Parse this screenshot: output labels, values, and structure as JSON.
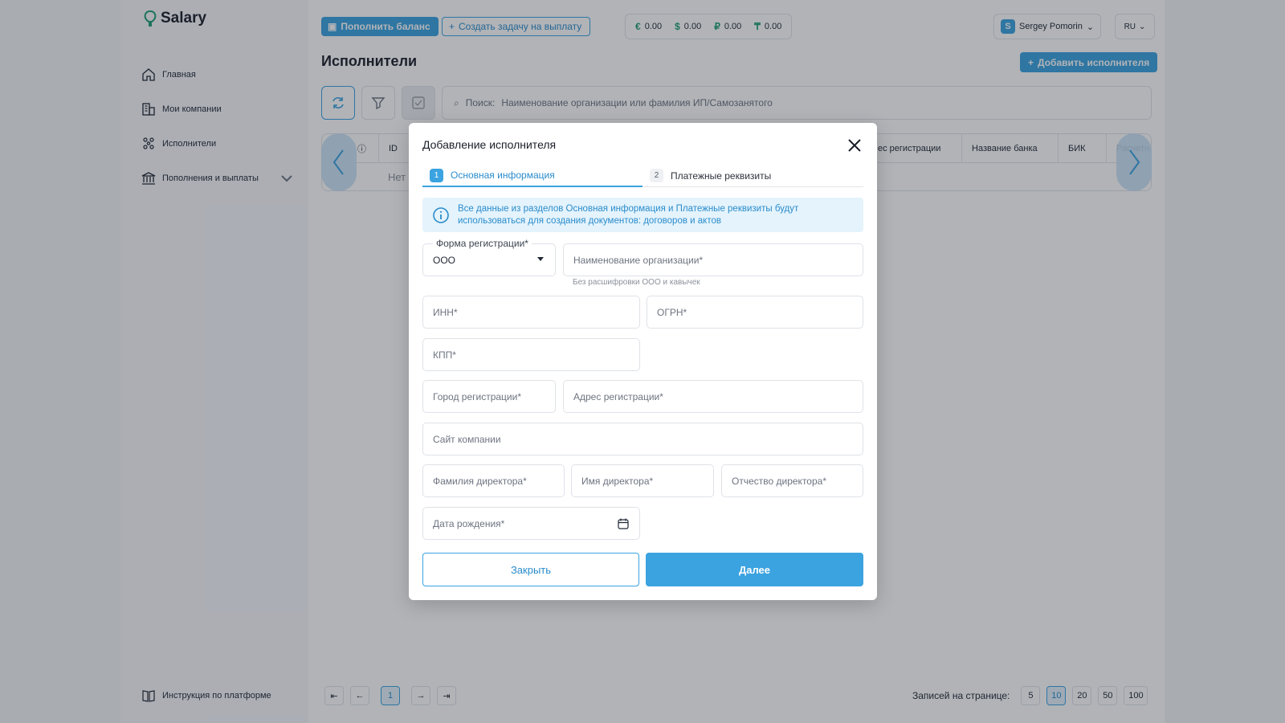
{
  "brand": {
    "name": "Salary"
  },
  "sidebar": {
    "items": [
      {
        "label": "Главная",
        "icon": "home-icon"
      },
      {
        "label": "Мои компании",
        "icon": "building-icon"
      },
      {
        "label": "Исполнители",
        "icon": "people-icon"
      },
      {
        "label": "Пополнения и выплаты",
        "icon": "bank-icon"
      }
    ],
    "footer_label": "Инструкция по платформе"
  },
  "topbar": {
    "topup_label": "Пополнить баланс",
    "create_task_label": "Создать задачу на выплату",
    "balances": [
      {
        "symbol": "€",
        "value": "0.00"
      },
      {
        "symbol": "$",
        "value": "0.00"
      },
      {
        "symbol": "₽",
        "value": "0.00"
      },
      {
        "symbol": "₸",
        "value": "0.00"
      }
    ],
    "user_initial": "S",
    "user_name": "Sergey Pomorin",
    "language": "RU"
  },
  "main": {
    "title": "Исполнители",
    "add_button": "Добавить исполнителя",
    "search_label": "Поиск:",
    "search_placeholder": "Наименование организации или фамилия ИП/Самозанятого",
    "table": {
      "columns": [
        "ID",
        "ес регистрации",
        "Название банка",
        "БИК",
        "Расчетн"
      ],
      "empty_text": "Нет"
    },
    "pagination": {
      "current_page": "1",
      "per_page_label": "Записей на странице:",
      "per_page_options": [
        "5",
        "10",
        "20",
        "50",
        "100"
      ],
      "selected_per_page": "10"
    }
  },
  "modal": {
    "title": "Добавление исполнителя",
    "steps": [
      {
        "num": "1",
        "label": "Основная информация"
      },
      {
        "num": "2",
        "label": "Платежные реквизиты"
      }
    ],
    "info_line1": "Все данные из разделов Основная информация и Платежные реквизиты будут",
    "info_line2": "использоваться для создания документов: договоров и актов",
    "fields": {
      "reg_form_label": "Форма регистрации*",
      "reg_form_value": "ООО",
      "org_name": "Наименование организации*",
      "org_name_hint": "Без расшифровки ООО и кавычек",
      "inn": "ИНН*",
      "ogrn": "ОГРН*",
      "kpp": "КПП*",
      "reg_city": "Город регистрации*",
      "reg_address": "Адрес регистрации*",
      "website": "Сайт компании",
      "director_last": "Фамилия директора*",
      "director_first": "Имя директора*",
      "director_middle": "Отчество директора*",
      "birth_date": "Дата рождения*"
    },
    "close_label": "Закрыть",
    "next_label": "Далее"
  }
}
